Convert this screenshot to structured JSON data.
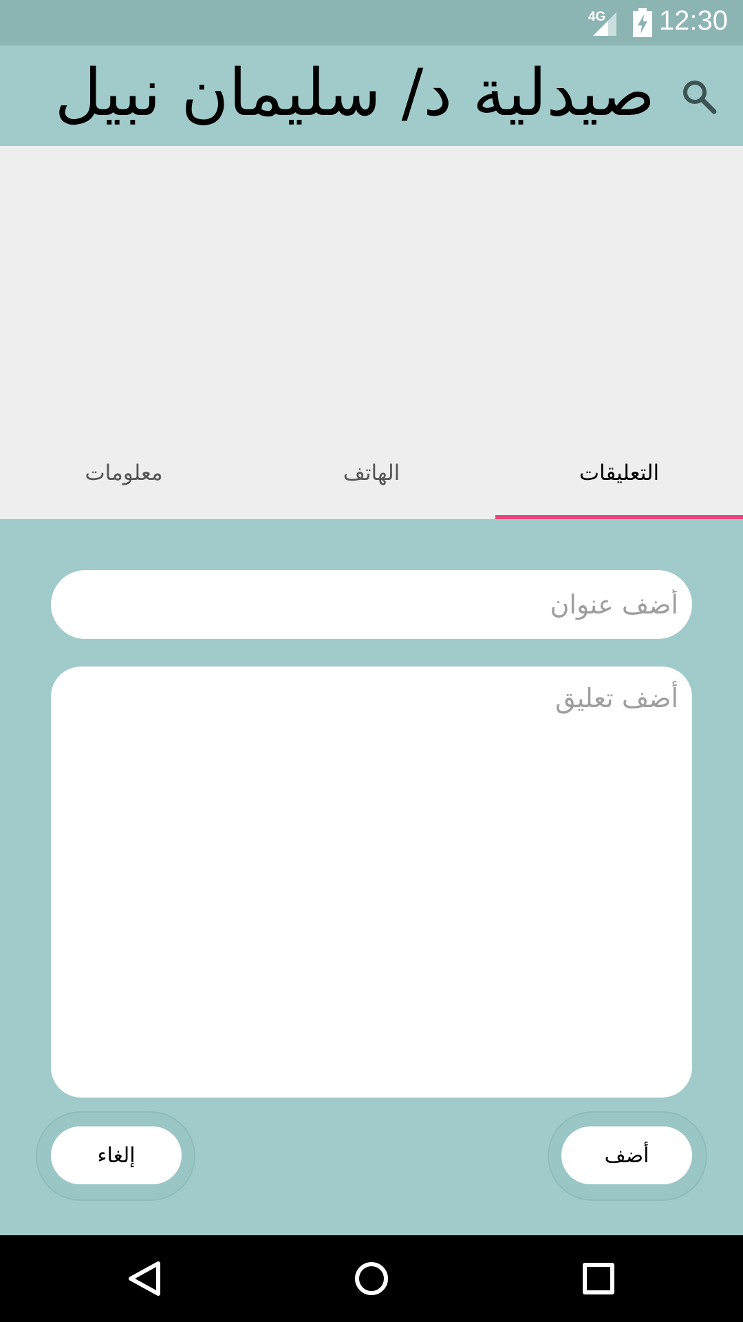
{
  "status_bar": {
    "network": "4G",
    "time": "12:30"
  },
  "app_bar": {
    "title": "صيدلية د/ سليمان نبيل",
    "search_icon": "search-icon"
  },
  "tabs": [
    {
      "label": "معلومات",
      "active": false
    },
    {
      "label": "الهاتف",
      "active": false
    },
    {
      "label": "التعليقات",
      "active": true
    }
  ],
  "form": {
    "title_placeholder": "أضف عنوان",
    "comment_placeholder": "أضف تعليق",
    "cancel_label": "إلغاء",
    "add_label": "أضف"
  },
  "colors": {
    "primary": "#a0cbca",
    "status_bar": "#8bb4b3",
    "tab_indicator": "#e8467a",
    "header_bg": "#eeeeee"
  },
  "nav_bar": {
    "back_icon": "back-triangle-icon",
    "home_icon": "home-circle-icon",
    "recents_icon": "recents-square-icon"
  }
}
